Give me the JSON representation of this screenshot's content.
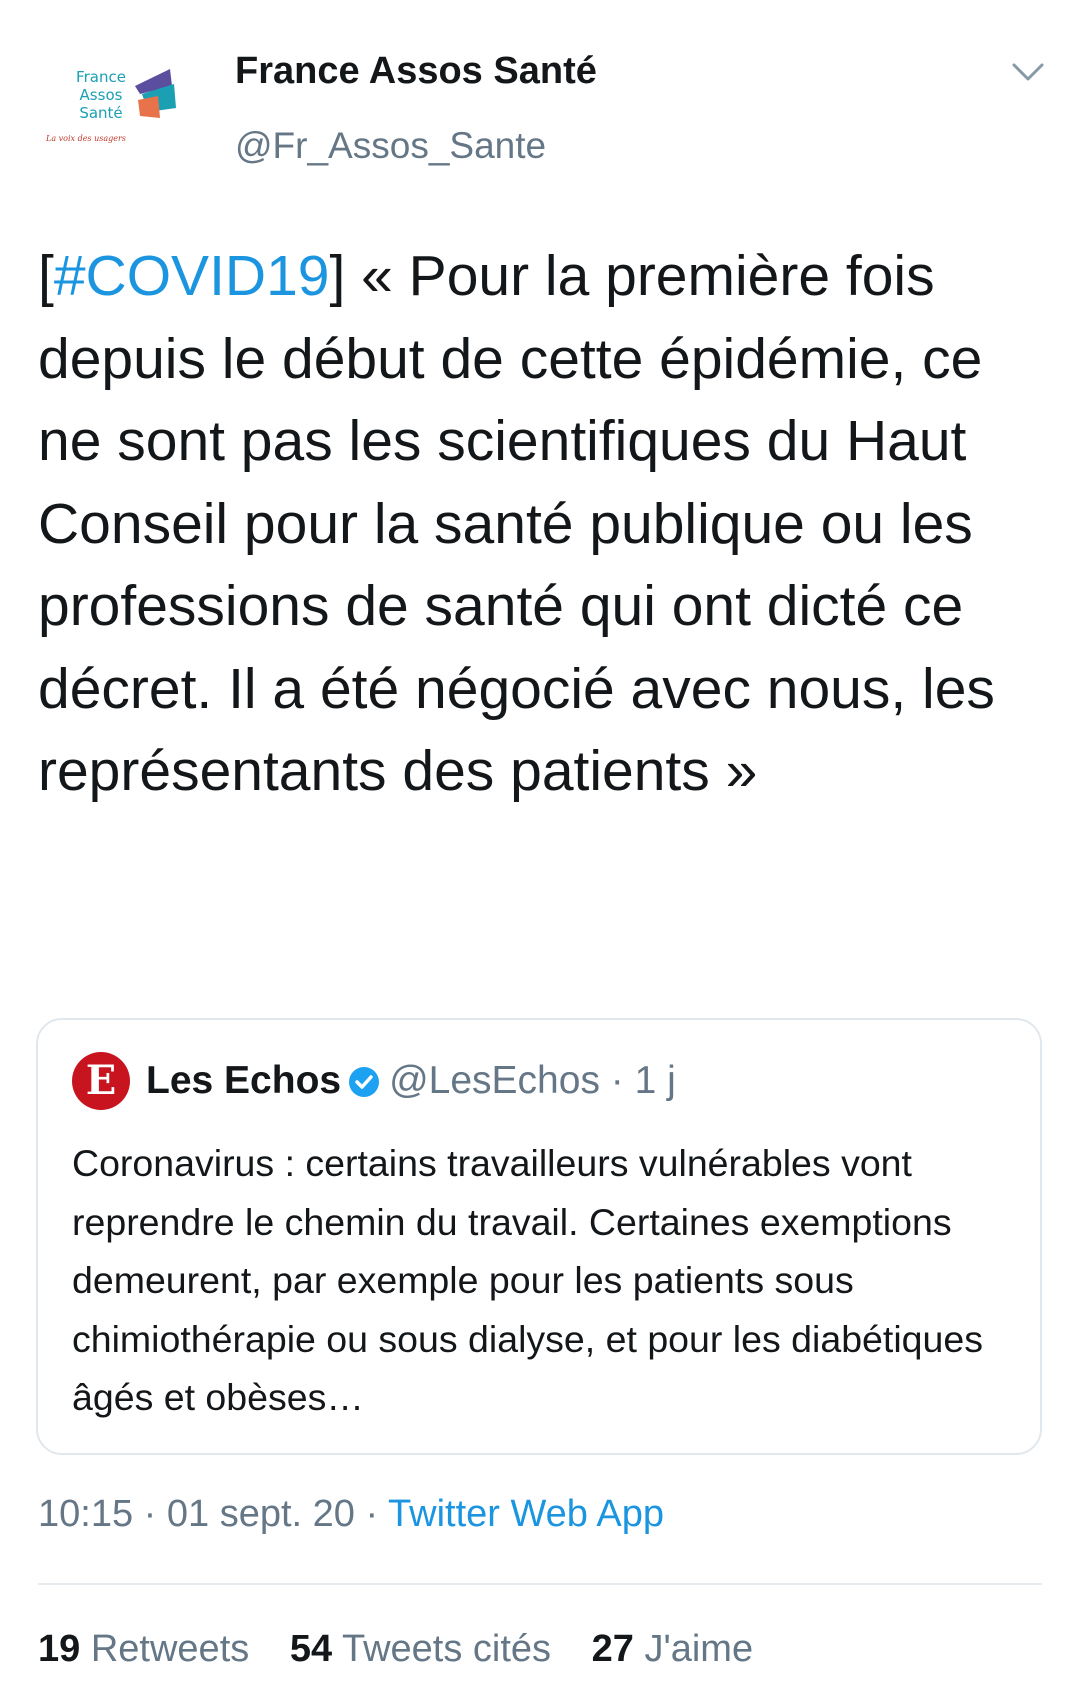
{
  "author": {
    "name": "France Assos Santé",
    "handle": "@Fr_Assos_Sante",
    "avatar_logo_lines": [
      "France",
      "Assos",
      "Santé"
    ],
    "avatar_tagline": "La voix des usagers"
  },
  "tweet": {
    "hashtag_open": "[",
    "hashtag": "#COVID19",
    "text_after_hashtag": "] « Pour la première fois depuis le début de cette épidémie, ce ne sont pas les scientifiques du Haut Conseil pour la santé publique ou les professions de santé qui ont dicté ce décret. Il a été négocié avec nous, les représentants des patients »"
  },
  "quoted_tweet": {
    "avatar_letter": "E",
    "name": "Les Echos",
    "handle": "@LesEchos",
    "separator": "·",
    "time": "1 j",
    "text": "Coronavirus : certains travailleurs vulnérables vont reprendre le chemin du travail. Certaines exemptions demeurent, par exemple pour les patients sous chimiothérapie ou sous dialyse, et pour les diabétiques âgés et obèses…"
  },
  "meta": {
    "time": "10:15",
    "separator": "·",
    "date": "01 sept. 20",
    "source": "Twitter Web App"
  },
  "stats": [
    {
      "count": "19",
      "label": "Retweets"
    },
    {
      "count": "54",
      "label": "Tweets cités"
    },
    {
      "count": "27",
      "label": "J'aime"
    }
  ],
  "colors": {
    "link": "#1b95e0",
    "secondary": "#657786",
    "primary_text": "#14171a",
    "verified": "#1da1f2",
    "les_echos_red": "#c8141e"
  },
  "icons": {
    "chevron": "chevron-down-icon",
    "verified": "verified-badge-icon"
  }
}
